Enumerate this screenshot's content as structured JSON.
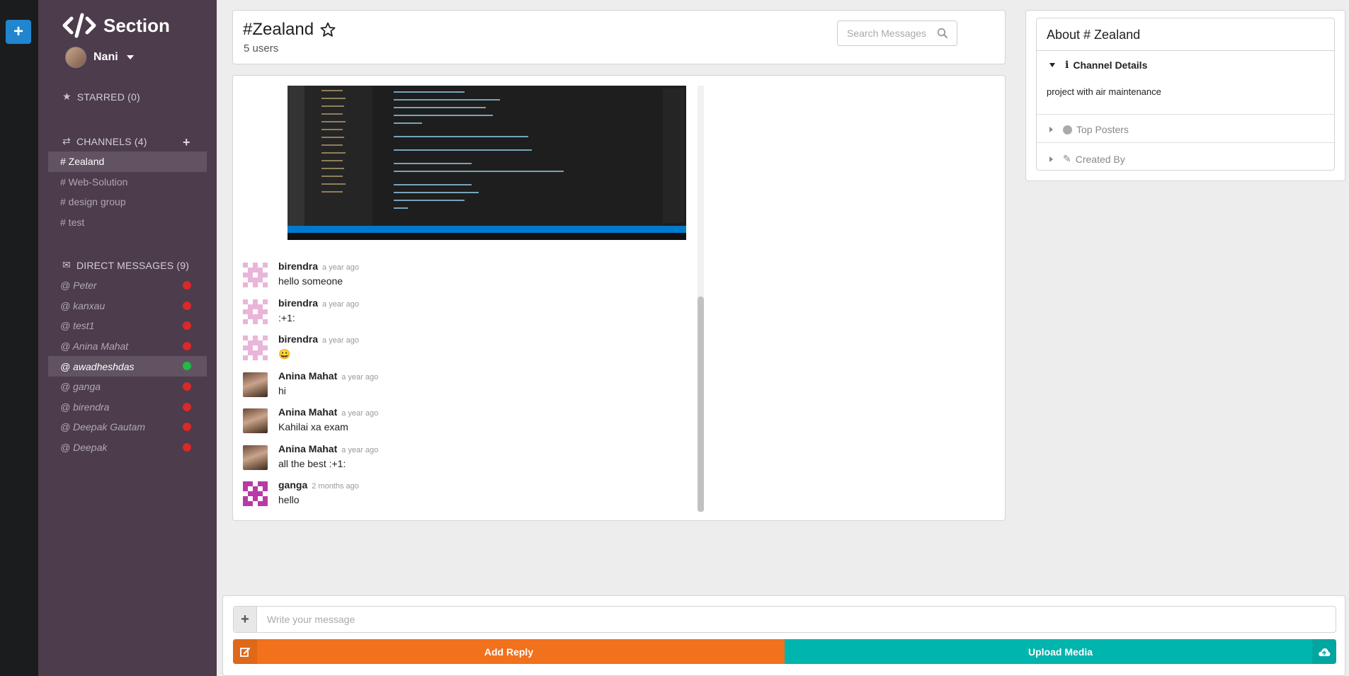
{
  "brand": {
    "name": "Section",
    "icon": "code-icon"
  },
  "user": {
    "name": "Nani"
  },
  "sidebar": {
    "starred_label": "STARRED (0)",
    "channels_label": "CHANNELS (4)",
    "channels": [
      {
        "label": "# Zealand",
        "active": true
      },
      {
        "label": "# Web-Solution",
        "active": false
      },
      {
        "label": "# design group",
        "active": false
      },
      {
        "label": "# test",
        "active": false
      }
    ],
    "dm_label": "DIRECT MESSAGES (9)",
    "direct_messages": [
      {
        "label": "@ Peter",
        "online": false
      },
      {
        "label": "@ kanxau",
        "online": false
      },
      {
        "label": "@ test1",
        "online": false
      },
      {
        "label": "@ Anina Mahat",
        "online": false
      },
      {
        "label": "@ awadheshdas",
        "online": true
      },
      {
        "label": "@ ganga",
        "online": false
      },
      {
        "label": "@ birendra",
        "online": false
      },
      {
        "label": "@ Deepak Gautam",
        "online": false
      },
      {
        "label": "@ Deepak",
        "online": false
      }
    ]
  },
  "header": {
    "title": "#Zealand",
    "users": "5 users",
    "search_placeholder": "Search Messages"
  },
  "messages": [
    {
      "author": "birendra",
      "time": "a year ago",
      "text": "hello someone",
      "avatar": "pink-identicon"
    },
    {
      "author": "birendra",
      "time": "a year ago",
      "text": ":+1:",
      "avatar": "pink-identicon"
    },
    {
      "author": "birendra",
      "time": "a year ago",
      "text": "😀",
      "avatar": "pink-identicon"
    },
    {
      "author": "Anina Mahat",
      "time": "a year ago",
      "text": "hi",
      "avatar": "photo"
    },
    {
      "author": "Anina Mahat",
      "time": "a year ago",
      "text": "Kahilai xa exam",
      "avatar": "photo"
    },
    {
      "author": "Anina Mahat",
      "time": "a year ago",
      "text": "all the best :+1:",
      "avatar": "photo"
    },
    {
      "author": "ganga",
      "time": "2 months ago",
      "text": "hello",
      "avatar": "magenta-identicon"
    }
  ],
  "about": {
    "title": "About # Zealand",
    "channel_details_label": "Channel Details",
    "description": "project with air maintenance",
    "top_posters_label": "Top Posters",
    "created_by_label": "Created By"
  },
  "composer": {
    "placeholder": "Write your message",
    "reply_label": "Add Reply",
    "upload_label": "Upload Media"
  },
  "colors": {
    "sidebar": "#4c3c4c",
    "rail": "#1b1c1d",
    "reply": "#f2711c",
    "upload": "#00b5ad",
    "online": "#21ba45",
    "offline": "#db2828",
    "add": "#2185d0"
  }
}
